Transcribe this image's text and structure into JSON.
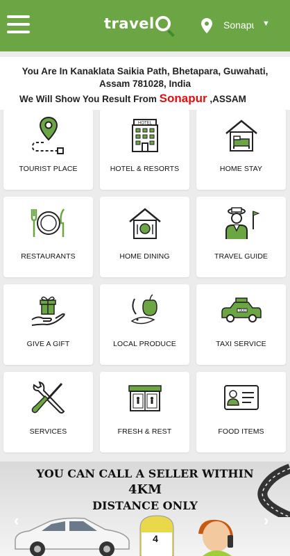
{
  "header": {
    "logo_text": "travel",
    "location_short": "Sonapur"
  },
  "info": {
    "address_line": "You Are In Kanaklata Saikia Path, Bhetapara, Guwahati, Assam 781028, India",
    "result_prefix": "We Will Show You Result From ",
    "result_city": "Sonapur",
    "result_state": " ,ASSAM"
  },
  "categories": [
    {
      "label": "TOURIST PLACE",
      "icon": "map-pin-route-icon"
    },
    {
      "label": "HOTEL & RESORTS",
      "icon": "hotel-building-icon"
    },
    {
      "label": "HOME STAY",
      "icon": "house-bed-icon"
    },
    {
      "label": "RESTAURANTS",
      "icon": "plate-fork-knife-icon"
    },
    {
      "label": "HOME DINING",
      "icon": "house-plate-icon"
    },
    {
      "label": "TRAVEL GUIDE",
      "icon": "guide-flag-icon"
    },
    {
      "label": "GIVE A GIFT",
      "icon": "hand-gift-icon"
    },
    {
      "label": "LOCAL PRODUCE",
      "icon": "produce-icon"
    },
    {
      "label": "TAXI SERVICE",
      "icon": "taxi-icon"
    },
    {
      "label": "SERVICES",
      "icon": "wrench-screwdriver-icon"
    },
    {
      "label": "FRESH & REST",
      "icon": "shop-icon"
    },
    {
      "label": "FOOD ITEMS",
      "icon": "id-card-icon"
    }
  ],
  "banner": {
    "line1": "YOU CAN CALL A SELLER WITHIN",
    "line2": "4KM",
    "line3": "DISTANCE ONLY",
    "sign_number": "4"
  },
  "colors": {
    "brand_green": "#6ca544",
    "accent_red": "#e01010"
  }
}
